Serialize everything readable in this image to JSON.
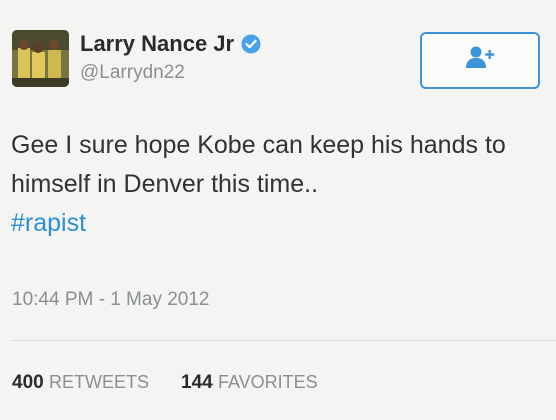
{
  "profile": {
    "display_name": "Larry Nance Jr",
    "handle": "@Larrydn22",
    "verified": true
  },
  "tweet": {
    "text": "Gee I sure hope Kobe can keep his hands to himself in Denver this time..",
    "hashtag": "#rapist",
    "timestamp": "10:44 PM - 1 May 2012"
  },
  "stats": {
    "retweets_count": "400",
    "retweets_label": "RETWEETS",
    "favorites_count": "144",
    "favorites_label": "FAVORITES"
  },
  "icons": {
    "follow": "follow-user-icon",
    "verified": "verified-badge-icon"
  },
  "colors": {
    "accent": "#3b94d9",
    "hashtag": "#2b8fd6",
    "muted": "#8a8f93",
    "background": "#f4f4f2"
  }
}
